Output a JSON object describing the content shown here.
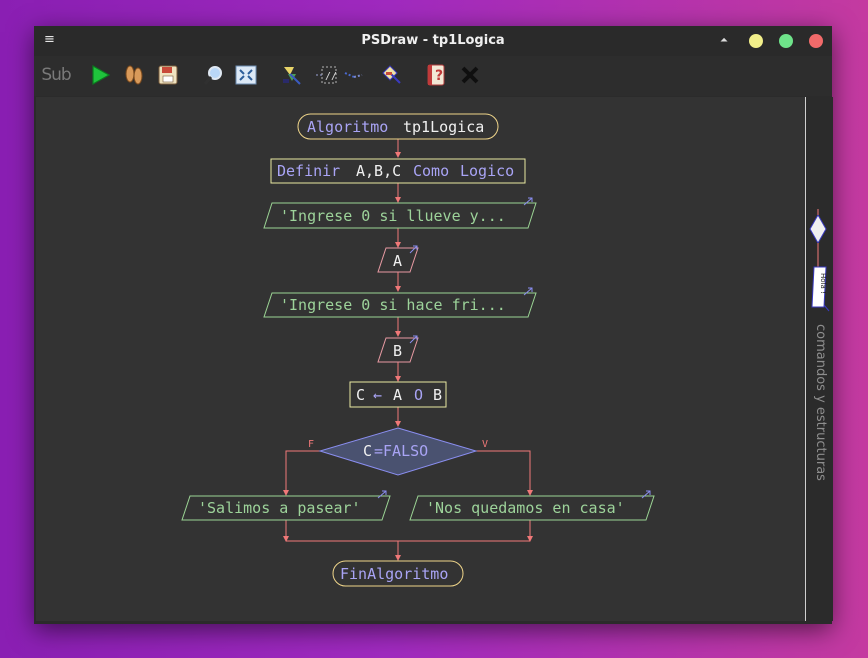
{
  "window": {
    "title": "PSDraw - tp1Logica"
  },
  "toolbar": {
    "sub_label": "Sub"
  },
  "flowchart": {
    "start_kw": "Algoritmo",
    "start_name": "tp1Logica",
    "define_kw": "Definir",
    "define_vars": "A,B,C",
    "define_como": "Como",
    "define_type": "Logico",
    "write1": "'Ingrese 0 si llueve y...",
    "read1": "A",
    "write2": "'Ingrese 0 si hace fri...",
    "read2": "B",
    "assign_target": "C",
    "assign_arrow": "←",
    "assign_a": "A",
    "assign_op": "O",
    "assign_b": "B",
    "cond_var": "C",
    "cond_rest": "=FALSO",
    "false_label": "F",
    "true_label": "V",
    "out_false": "'Salimos a pasear'",
    "out_true": "'Nos quedamos en casa'",
    "end": "FinAlgoritmo"
  },
  "sidebar": {
    "label": "comandos y estructuras",
    "mini_write": "Hola !"
  },
  "colors": {
    "keyword": "#a9a4f5",
    "identifier": "#f0f0f0",
    "string": "#9dd39a",
    "arrow": "#f07878",
    "start_border": "#efd58a",
    "process_border": "#e8e8a0",
    "io_border": "#9bd494",
    "read_border": "#e89aa3",
    "decision_border": "#8a8ef0",
    "decision_fill": "#4a5270"
  }
}
